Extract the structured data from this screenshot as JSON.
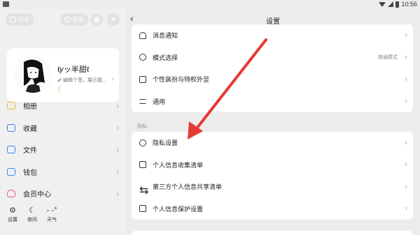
{
  "status_bar": {
    "time": "10:56"
  },
  "drawer": {
    "top_buttons": {
      "checkin": "打卡",
      "status": "状态"
    },
    "profile": {
      "username": "ℓ𝑦ッ半甜ℓ",
      "bio": "编辑个签，展示我..."
    },
    "menu": [
      {
        "label": "相册",
        "icon": "photo-icon"
      },
      {
        "label": "收藏",
        "icon": "bookmark-icon"
      },
      {
        "label": "文件",
        "icon": "folder-icon"
      },
      {
        "label": "钱包",
        "icon": "wallet-icon"
      },
      {
        "label": "会员中心",
        "icon": "vip-icon"
      }
    ],
    "bottom": {
      "settings": "设置",
      "night": "夜间",
      "weather": "天气",
      "temp": "- -°"
    }
  },
  "settings": {
    "title": "设置",
    "group1": [
      {
        "label": "消息通知",
        "icon": "bell-icon",
        "value": ""
      },
      {
        "label": "模式选择",
        "icon": "mode-icon",
        "value": "普通模式"
      },
      {
        "label": "个性装扮与特权外显",
        "icon": "shirt-icon",
        "value": ""
      },
      {
        "label": "通用",
        "icon": "sliders-icon",
        "value": ""
      }
    ],
    "privacy_header": "隐私",
    "group2": [
      {
        "label": "隐私设置",
        "icon": "shield-icon"
      },
      {
        "label": "个人信息收集清单",
        "icon": "document-icon"
      },
      {
        "label": "第三方个人信息共享清单",
        "icon": "share-icon"
      },
      {
        "label": "个人信息保护设置",
        "icon": "check-shield-icon"
      }
    ]
  },
  "colors": {
    "accent": "#3a82f7",
    "annotation_arrow": "#e53935",
    "moon": "#e8b53a"
  }
}
